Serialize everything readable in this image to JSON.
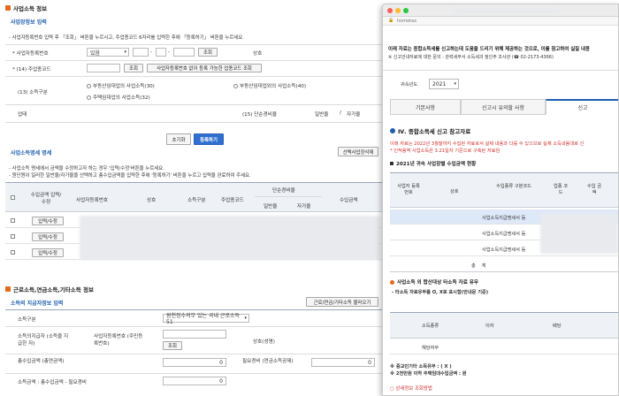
{
  "main": {
    "section1": {
      "title": "사업소득 정보",
      "subtitle": "사업장정보 입력",
      "note": "- 사업자등록번호 입력 후 「조회」 버튼을 누르시고, 주업종코드 6자리를 입력한 후에 「등록하기」 버튼을 누르세요.",
      "biz_no_label": "* 사업자등록번호",
      "has_select": "있음",
      "lookup_btn": "조회",
      "company_label": "상호",
      "industry_label": "* (14) 주업종코드",
      "industry_lookup_btn": "조회",
      "industry_nobiz_btn": "사업자등록번호 없이 등록 가능한 업종코드 조회",
      "income_type_label": "(13) 소득구분",
      "radio1": "부동산임대업의 사업소득(30)",
      "radio2": "부동산임대업외의 사업소득(40)",
      "radio3": "주택임대업의 사업소득(32)",
      "business_label": "업태",
      "simple_rate_label": "(15) 단순경비율",
      "general_label": "일반율",
      "self_label": "자가율",
      "reset_btn": "초기화",
      "register_btn": "등록하기"
    },
    "section2": {
      "subtitle": "사업소득명세 명세",
      "note1": "- 사업소득 명세에서 금액을 수정하고자 하는 경우 '입력/수정'버튼을 누르세요.",
      "note2": "- 원단원이 일러한 일반율/자가율을 선택하고 총수입금액을 입력한 후에 '등록하기' 버튼을 누르고 입력을 완료하여 주세요.",
      "delete_btn": "선택사업장삭제",
      "headers": {
        "edit": "수입금액 입력/수정",
        "biz_no": "사업자등록번호",
        "company": "상호",
        "income_type": "소득구분",
        "industry": "주업종코드",
        "rate": "단순경비율",
        "general": "일반율",
        "self": "자가율",
        "income": "수입금액"
      },
      "row_btn": "입력/수정"
    },
    "section3": {
      "title": "근로소득,연금소득,기타소득 정보",
      "subtitle": "소득의 지급자정보 입력",
      "load_btn": "근로/연금/기타소득 불러오기",
      "income_type_label": "소득구분",
      "income_type_value": "원천징수의무 있는 국내 근로소득 51",
      "payer_label": "소득의지급자 (소득을 지급한 자)",
      "payer_biz_label": "사업자등록번호 (주민등록번호)",
      "payer_lookup_btn": "조회",
      "company_label": "상호(성명)",
      "total_income_label": "총수입금액 (총연금액)",
      "total_income_value": "0",
      "necessary_label": "필요경비 (연금소득공제)",
      "necessary_value": "0",
      "income_amount_label": "소득금액 : 총수입금액 - 필요경비",
      "income_amount_value": "0"
    }
  },
  "popup": {
    "url": "hometax",
    "intro": "이래 자료는 종합소득세를 신고하는데 도움을 드리기 위해 제공하는 것으로, 이를 참고하여 실질 내용",
    "contact": "※ 신고안내자료에 대한 문의 : 관력세무서 소득세과 정인주 조사관 (☎ 02-2173-4366)",
    "year_label": "귀속년도",
    "year_value": "2021",
    "tabs": [
      "기본사항",
      "신고시 유의할 사항",
      "신고"
    ],
    "section_title": "Ⅳ. 종합소득세 신고 참고자료",
    "red_note1": "이래 자료는 2022년 3월말까지 수집된 자료로서 실제 내용과 다를 수 있으므로 실제 소득내용대로 신",
    "red_note2": "* 인적용역 사업소득은 3.21일자 기준으로 구축된 자료임",
    "table_title": "2021년 귀속 사업장별 수입금액 현황",
    "headers": {
      "biz_no": "사업자 등록번호",
      "company": "상호",
      "income_type": "수입종류 구분코드",
      "industry": "업종 코드",
      "income": "수입 금액"
    },
    "rows": [
      "사업소득지급명세서 등",
      "사업소득지급명세서 등",
      "사업소득지급명세서 등"
    ],
    "total_label": "총    계",
    "section2_title": "사업소득 외 합산대상 타소득 자료 유무",
    "section2_sub": "- 타소득 자료유무를 O, X로 표시함(안내문 기준)",
    "table2_headers": {
      "type": "소득종류",
      "interest": "이자",
      "dividend": "배당"
    },
    "table2_row": "해당여부",
    "note_a": "※ 중교인기타 소득유무 : ( X )",
    "note_b": "※ 2천만원 이하 주택임대수입금액 : 원",
    "detail_link": "○ 상세정보 조회방법"
  },
  "colors": {
    "accent_blue": "#2f6fd0",
    "accent_orange": "#e26a1a",
    "link_blue": "#1f5fae",
    "red": "#d32d2d"
  }
}
